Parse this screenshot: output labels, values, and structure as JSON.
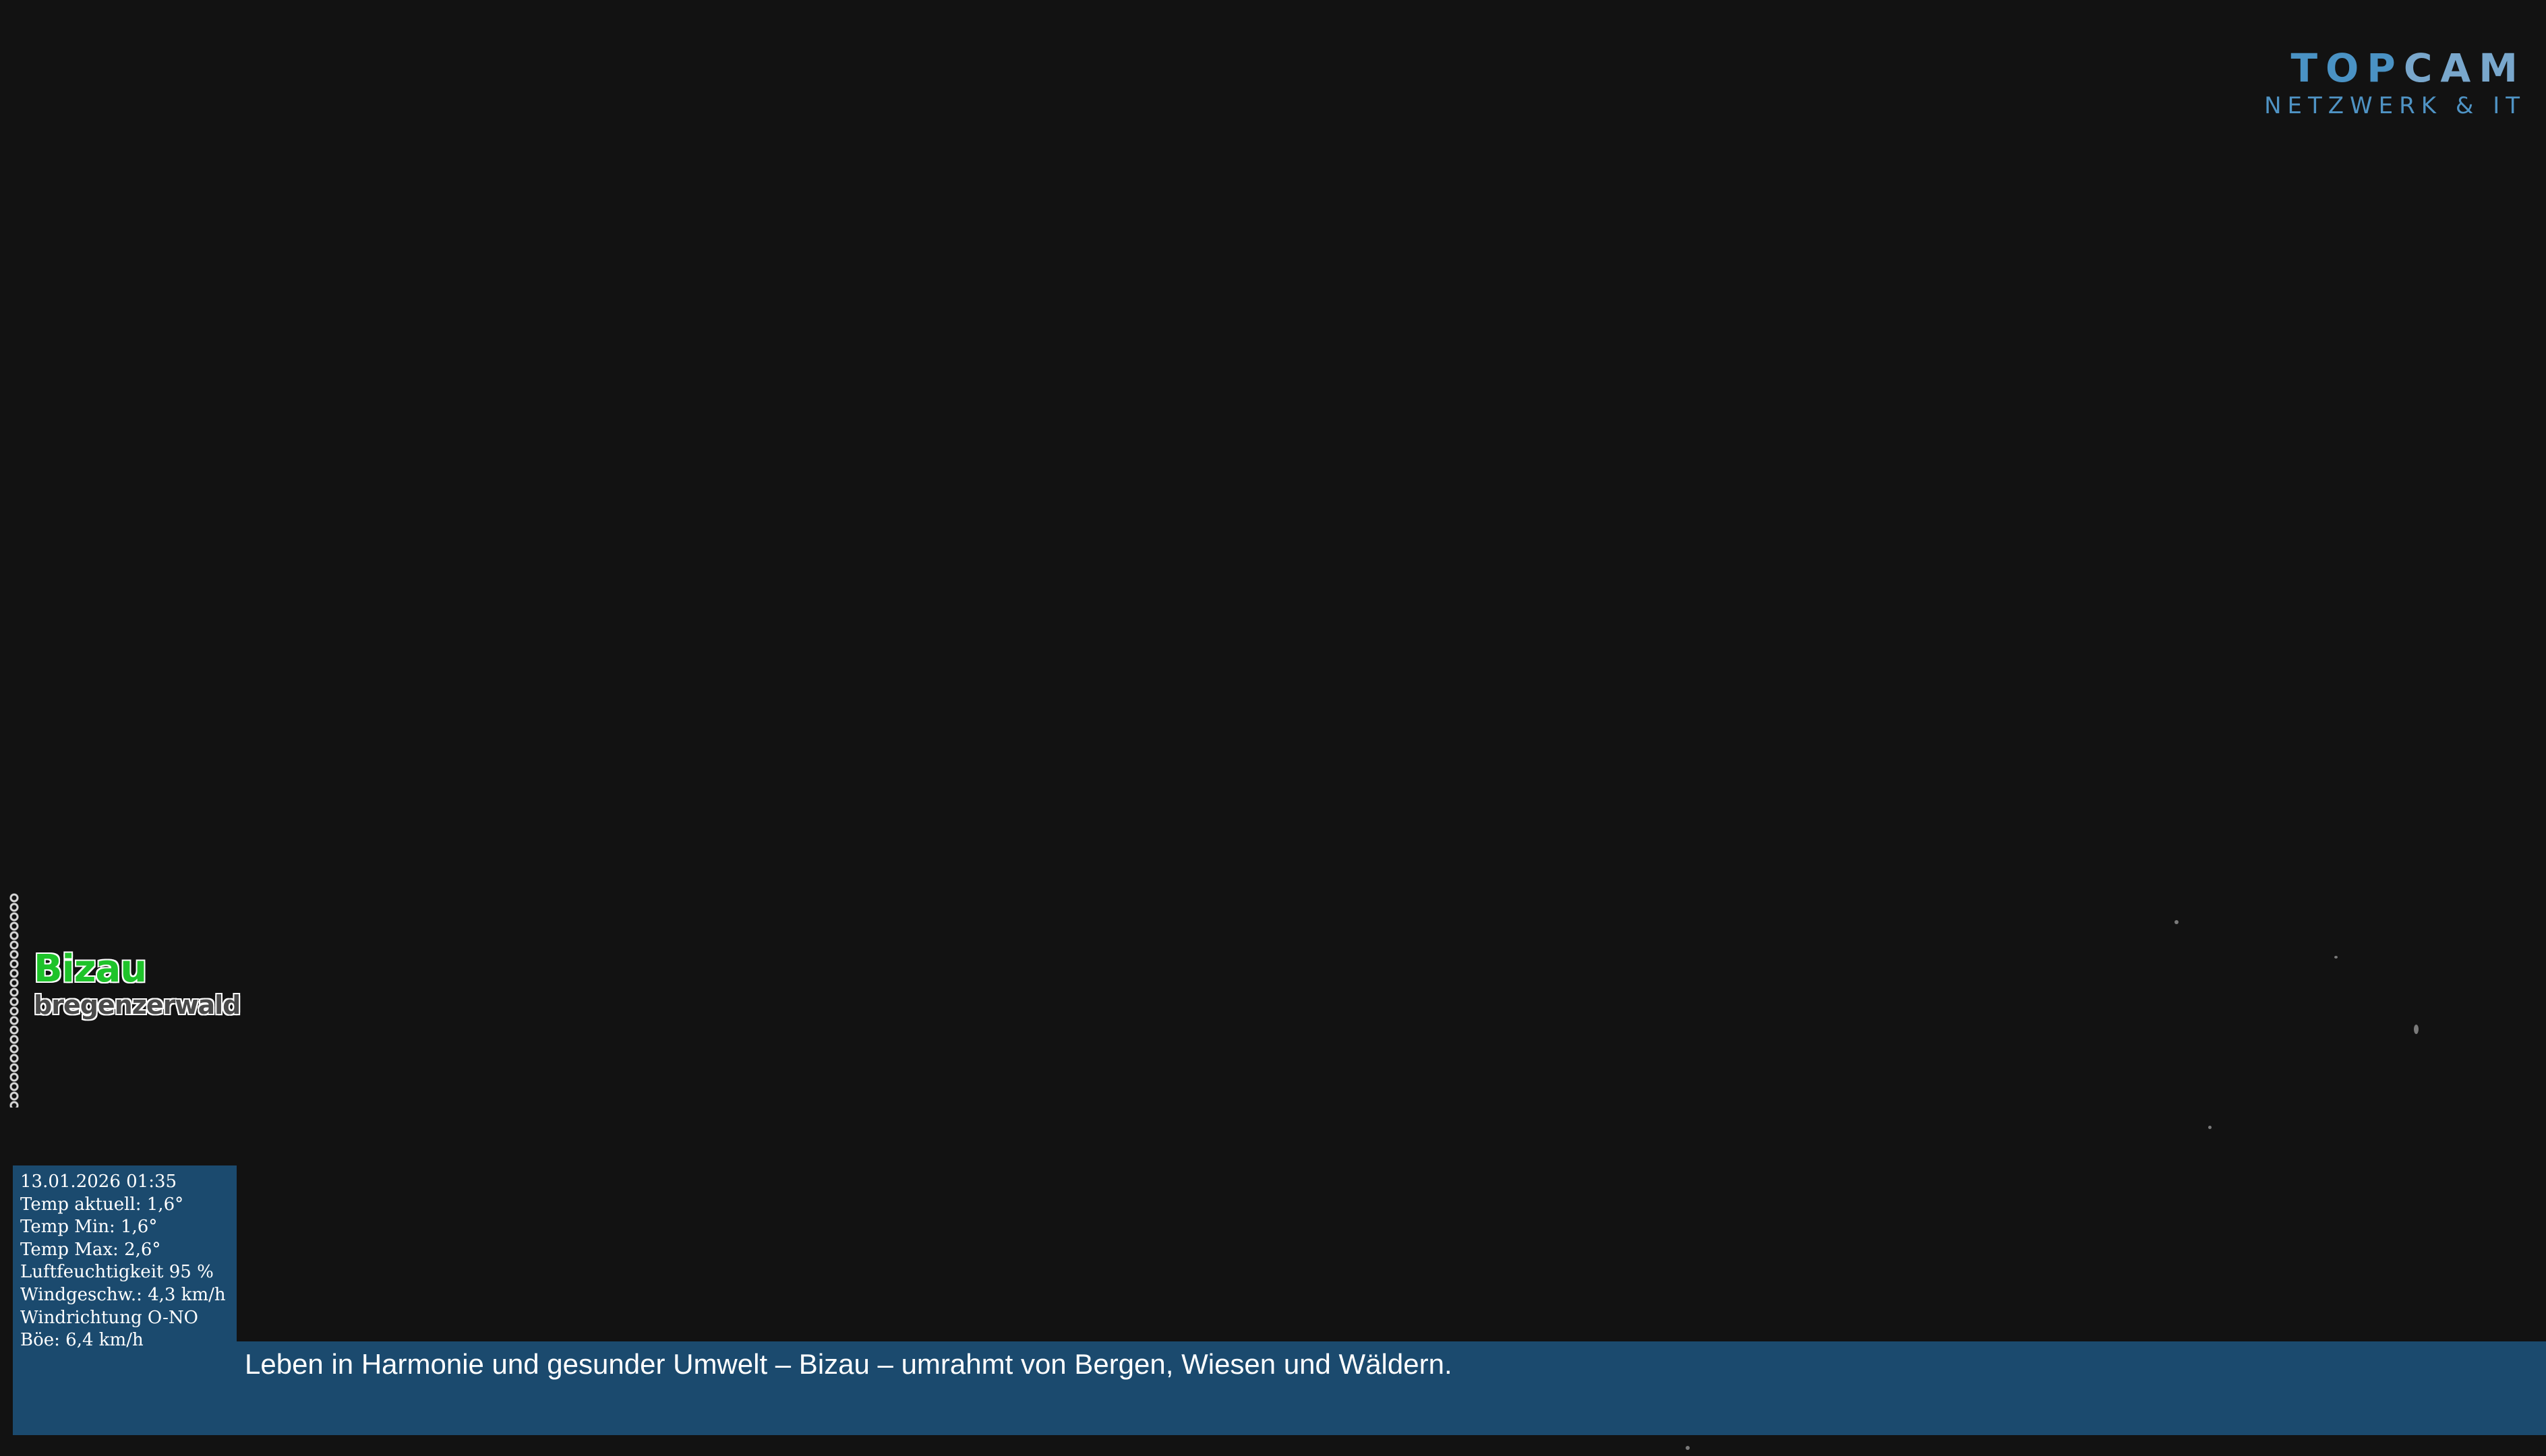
{
  "brand": {
    "name_part1": "TOP",
    "name_part2": "CAM",
    "tagline": "NETZWERK & IT"
  },
  "location": {
    "name": "Bizau",
    "region": "bregenzerwald"
  },
  "weather": {
    "timestamp": "13.01.2026 01:35",
    "temp_current": "Temp aktuell: 1,6°",
    "temp_min": "Temp Min: 1,6°",
    "temp_max": "Temp Max: 2,6°",
    "humidity": "Luftfeuchtigkeit 95 %",
    "wind_speed": "Windgeschw.: 4,3 km/h",
    "wind_direction": "Windrichtung O-NO",
    "gust": "Böe: 6,4 km/h"
  },
  "banner": {
    "text": "Leben in Harmonie und gesunder Umwelt – Bizau – umrahmt von Bergen, Wiesen und Wäldern."
  }
}
